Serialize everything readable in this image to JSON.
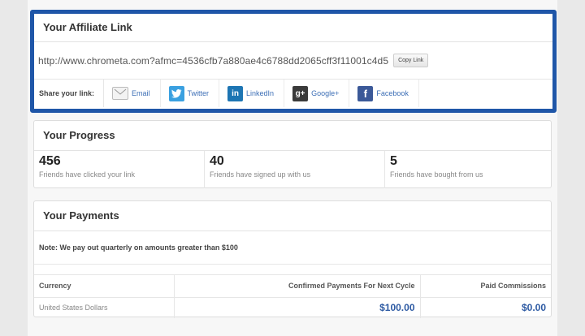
{
  "affiliate": {
    "title": "Your Affiliate Link",
    "url": "http://www.chrometa.com?afmc=4536cfb7a880ae4c6788dd2065cff3f11001c4d5",
    "copy_label": "Copy Link",
    "share_label": "Share your link:",
    "share": [
      {
        "label": "Email",
        "icon": "envelope-icon"
      },
      {
        "label": "Twitter",
        "icon": "twitter-icon"
      },
      {
        "label": "LinkedIn",
        "icon": "linkedin-icon"
      },
      {
        "label": "Google+",
        "icon": "google-plus-icon"
      },
      {
        "label": "Facebook",
        "icon": "facebook-icon"
      }
    ],
    "accent_color": "#1f56a8"
  },
  "progress": {
    "title": "Your Progress",
    "stats": [
      {
        "value": "456",
        "label": "Friends have clicked your link"
      },
      {
        "value": "40",
        "label": "Friends have signed up with us"
      },
      {
        "value": "5",
        "label": "Friends have bought from us"
      }
    ]
  },
  "payments": {
    "title": "Your Payments",
    "note": "Note: We pay out quarterly on amounts greater than $100",
    "columns": [
      "Currency",
      "Confirmed Payments For Next Cycle",
      "Paid Commissions"
    ],
    "rows": [
      {
        "currency": "United States Dollars",
        "confirmed": "$100.00",
        "paid": "$0.00"
      }
    ],
    "amount_color": "#2d5aa3"
  }
}
